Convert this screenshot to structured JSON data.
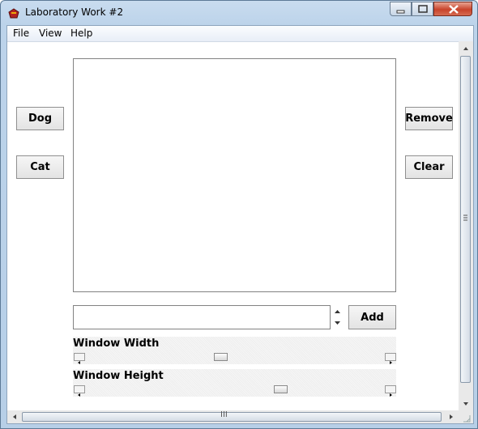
{
  "window": {
    "title": "Laboratory Work #2"
  },
  "menu": {
    "items": [
      "File",
      "View",
      "Help"
    ]
  },
  "buttons": {
    "dog": "Dog",
    "cat": "Cat",
    "remove": "Remove",
    "clear": "Clear",
    "add": "Add"
  },
  "list": {
    "items": []
  },
  "input": {
    "value": ""
  },
  "sliders": {
    "width": {
      "label": "Window Width",
      "level": 0.45
    },
    "height": {
      "label": "Window Height",
      "level": 0.66
    }
  },
  "colors": {
    "accent": "#0a246a",
    "close_button": "#c8432a"
  },
  "scrollbar_glyph": "III"
}
